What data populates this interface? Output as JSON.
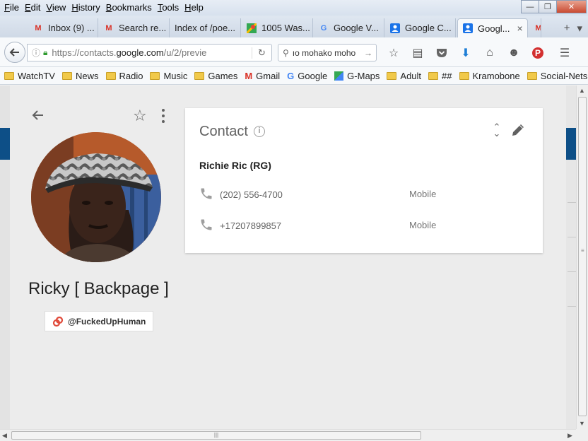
{
  "menu": [
    "File",
    "Edit",
    "View",
    "History",
    "Bookmarks",
    "Tools",
    "Help"
  ],
  "window_controls": {
    "minimize": "—",
    "restore": "❐",
    "close": "✕"
  },
  "tabs": [
    {
      "label": "Inbox (9) ...",
      "icon": "gmail-icon"
    },
    {
      "label": "Search re...",
      "icon": "gmail-icon"
    },
    {
      "label": "Index of /poe...",
      "icon": "none"
    },
    {
      "label": "1005 Was...",
      "icon": "maps-icon"
    },
    {
      "label": "Google V...",
      "icon": "google-icon"
    },
    {
      "label": "Google C...",
      "icon": "contacts-icon"
    },
    {
      "label": "Googl...",
      "icon": "contacts-icon",
      "active": true
    },
    {
      "label": "",
      "icon": "gmail-icon"
    }
  ],
  "tab_close": "×",
  "new_tab": "+",
  "address": {
    "prefix": "https://contacts.",
    "domain": "google.com",
    "suffix": "/u/2/previe"
  },
  "search": {
    "value": "ıo mohako moho"
  },
  "bookmarks": [
    {
      "label": "WatchTV",
      "icon": "folder"
    },
    {
      "label": "News",
      "icon": "folder"
    },
    {
      "label": "Radio",
      "icon": "folder"
    },
    {
      "label": "Music",
      "icon": "folder"
    },
    {
      "label": "Games",
      "icon": "folder"
    },
    {
      "label": "Gmail",
      "icon": "gmail"
    },
    {
      "label": "Google",
      "icon": "google"
    },
    {
      "label": "G-Maps",
      "icon": "maps"
    },
    {
      "label": "Adult",
      "icon": "folder"
    },
    {
      "label": "##",
      "icon": "folder"
    },
    {
      "label": "Kramobone",
      "icon": "folder"
    },
    {
      "label": "Social-Nets",
      "icon": "folder"
    }
  ],
  "contact": {
    "name": "Ricky [ Backpage ]",
    "handle": "@FuckedUpHuman",
    "card_title": "Contact",
    "display_name": "Richie Ric (RG)",
    "phones": [
      {
        "number": "(202) 556-4700",
        "type": "Mobile"
      },
      {
        "number": "+17207899857",
        "type": "Mobile"
      }
    ]
  },
  "colors": {
    "accent_blue": "#0d4f87",
    "page_bg": "#ececec",
    "card_bg": "#ffffff"
  }
}
